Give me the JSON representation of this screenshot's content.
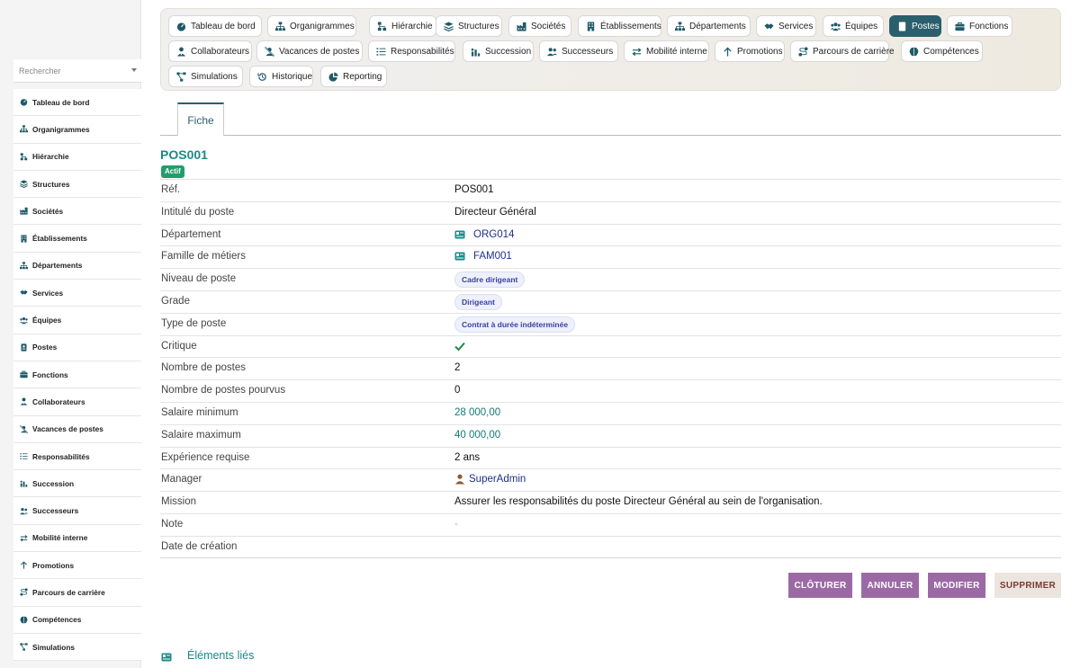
{
  "sidebar": {
    "search_placeholder": "Rechercher",
    "items": [
      {
        "label": "Tableau de bord",
        "icon": "dashboard-icon"
      },
      {
        "label": "Organigrammes",
        "icon": "sitemap-icon"
      },
      {
        "label": "Hiérarchie",
        "icon": "hierarchy-icon"
      },
      {
        "label": "Structures",
        "icon": "layers-icon"
      },
      {
        "label": "Sociétés",
        "icon": "industry-icon"
      },
      {
        "label": "Établissements",
        "icon": "building-icon"
      },
      {
        "label": "Départements",
        "icon": "sitemap-icon"
      },
      {
        "label": "Services",
        "icon": "handshake-icon"
      },
      {
        "label": "Équipes",
        "icon": "users-icon"
      },
      {
        "label": "Postes",
        "icon": "id-badge-icon"
      },
      {
        "label": "Fonctions",
        "icon": "briefcase-icon"
      },
      {
        "label": "Collaborateurs",
        "icon": "user-tie-icon"
      },
      {
        "label": "Vacances de postes",
        "icon": "user-slash-icon"
      },
      {
        "label": "Responsabilités",
        "icon": "list-icon"
      },
      {
        "label": "Succession",
        "icon": "succession-icon"
      },
      {
        "label": "Successeurs",
        "icon": "user-friends-icon"
      },
      {
        "label": "Mobilité interne",
        "icon": "exchange-icon"
      },
      {
        "label": "Promotions",
        "icon": "arrow-up-icon"
      },
      {
        "label": "Parcours de carrière",
        "icon": "route-icon"
      },
      {
        "label": "Compétences",
        "icon": "brain-icon"
      },
      {
        "label": "Simulations",
        "icon": "project-diagram-icon"
      }
    ]
  },
  "nav": {
    "chips": [
      {
        "label": "Tableau de bord",
        "icon": "dashboard-icon"
      },
      {
        "label": "Organigrammes",
        "icon": "sitemap-icon"
      },
      {
        "label": "Hiérarchie",
        "icon": "hierarchy-icon"
      },
      {
        "label": "Structures",
        "icon": "layers-icon"
      },
      {
        "label": "Sociétés",
        "icon": "industry-icon"
      },
      {
        "label": "Établissements",
        "icon": "building-icon"
      },
      {
        "label": "Départements",
        "icon": "sitemap-icon"
      },
      {
        "label": "Services",
        "icon": "handshake-icon"
      },
      {
        "label": "Équipes",
        "icon": "users-icon"
      },
      {
        "label": "Postes",
        "icon": "id-badge-icon",
        "active": true
      },
      {
        "label": "Fonctions",
        "icon": "briefcase-icon"
      },
      {
        "label": "Collaborateurs",
        "icon": "user-tie-icon"
      },
      {
        "label": "Vacances de postes",
        "icon": "user-slash-icon"
      },
      {
        "label": "Responsabilités",
        "icon": "list-icon"
      },
      {
        "label": "Succession",
        "icon": "succession-icon"
      },
      {
        "label": "Successeurs",
        "icon": "user-friends-icon"
      },
      {
        "label": "Mobilité interne",
        "icon": "exchange-icon"
      },
      {
        "label": "Promotions",
        "icon": "arrow-up-icon"
      },
      {
        "label": "Parcours de carrière",
        "icon": "route-icon"
      },
      {
        "label": "Compétences",
        "icon": "brain-icon"
      },
      {
        "label": "Simulations",
        "icon": "project-diagram-icon"
      },
      {
        "label": "Historique",
        "icon": "history-icon"
      },
      {
        "label": "Reporting",
        "icon": "chart-pie-icon"
      }
    ]
  },
  "tabs": {
    "fiche": "Fiche"
  },
  "record": {
    "title": "POS001",
    "status": "Actif",
    "status_color": "#239e6b",
    "accent_color": "#1b8a87"
  },
  "fields": [
    {
      "label": "Réf.",
      "value": "POS001",
      "kind": "text"
    },
    {
      "label": "Intitulé du poste",
      "value": "Directeur Général",
      "kind": "text"
    },
    {
      "label": "Département",
      "value": "ORG014",
      "kind": "link-icon",
      "icon": "org-card-icon"
    },
    {
      "label": "Famille de métiers",
      "value": "FAM001",
      "kind": "link-icon",
      "icon": "org-card-icon"
    },
    {
      "label": "Niveau de poste",
      "value": "Cadre dirigeant",
      "kind": "pill"
    },
    {
      "label": "Grade",
      "value": "Dirigeant",
      "kind": "pill"
    },
    {
      "label": "Type de poste",
      "value": "Contrat à durée indéterminée",
      "kind": "pill"
    },
    {
      "label": "Critique",
      "value": "",
      "kind": "check",
      "icon": "check-icon",
      "checked": true
    },
    {
      "label": "Nombre de postes",
      "value": "2",
      "kind": "text"
    },
    {
      "label": "Nombre de postes pourvus",
      "value": "0",
      "kind": "text"
    },
    {
      "label": "Salaire minimum",
      "value": "28 000,00",
      "kind": "teal"
    },
    {
      "label": "Salaire maximum",
      "value": "40 000,00",
      "kind": "teal"
    },
    {
      "label": "Expérience requise",
      "value": "2 ans",
      "kind": "text"
    },
    {
      "label": "Manager",
      "value": "SuperAdmin",
      "kind": "user",
      "icon": "user-icon"
    },
    {
      "label": "Mission",
      "value": "Assurer les responsabilités du poste Directeur Général au sein de l'organisation.",
      "kind": "text"
    },
    {
      "label": "Note",
      "value": "-",
      "kind": "dash"
    },
    {
      "label": "Date de création",
      "value": "",
      "kind": "text"
    }
  ],
  "actions": {
    "cloturer": "CLÔTURER",
    "annuler": "ANNULER",
    "modifier": "MODIFIER",
    "supprimer": "SUPPRIMER"
  },
  "linked": {
    "title": "Éléments liés",
    "icon": "org-card-icon"
  }
}
